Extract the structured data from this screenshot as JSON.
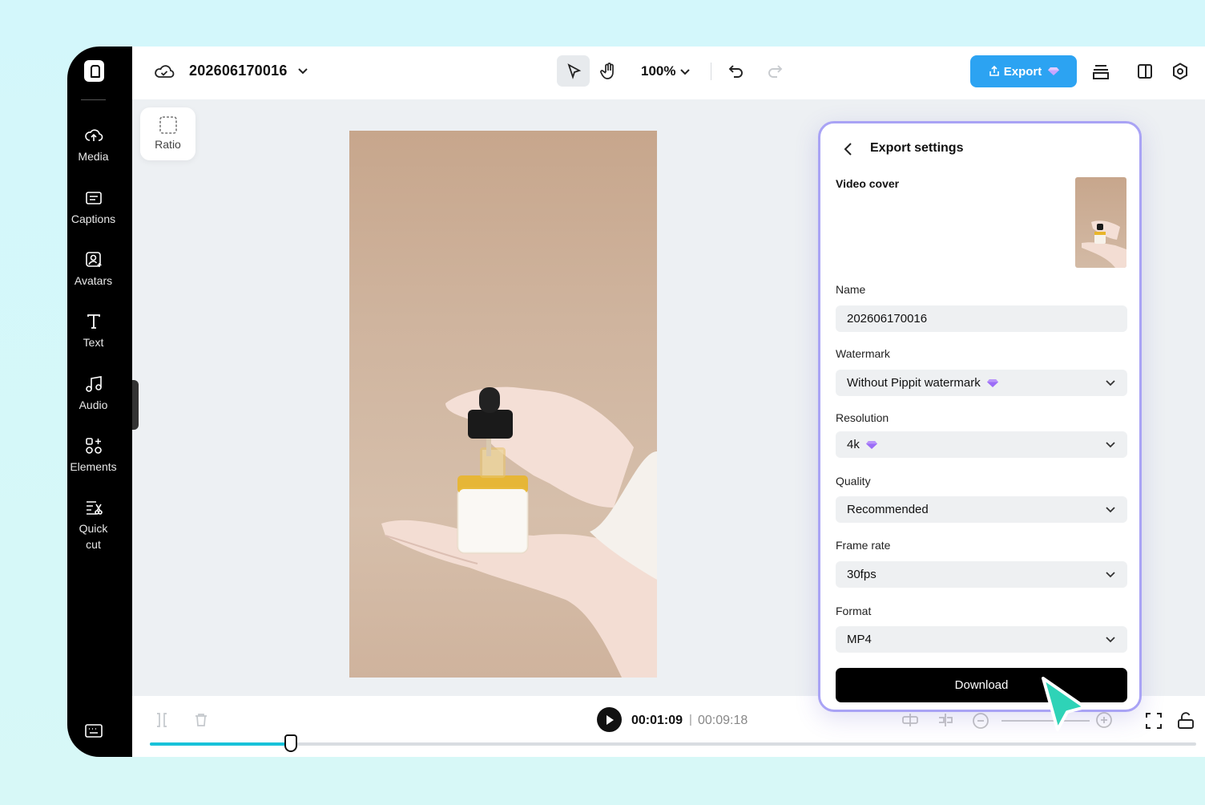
{
  "sidebar": {
    "items": [
      {
        "label": "Media",
        "icon": "cloud-upload-icon"
      },
      {
        "label": "Captions",
        "icon": "captions-icon"
      },
      {
        "label": "Avatars",
        "icon": "avatar-icon"
      },
      {
        "label": "Text",
        "icon": "text-icon"
      },
      {
        "label": "Audio",
        "icon": "music-note-icon"
      },
      {
        "label": "Elements",
        "icon": "elements-icon"
      },
      {
        "label": "Quick",
        "label2": "cut",
        "icon": "quick-cut-icon"
      }
    ]
  },
  "header": {
    "project_title": "202606170016",
    "zoom": "100%",
    "export_label": "Export"
  },
  "canvas": {
    "ratio_label": "Ratio"
  },
  "timeline": {
    "current_time": "00:01:09",
    "separator": "|",
    "total_time": "00:09:18",
    "progress": 0.135
  },
  "export_panel": {
    "title": "Export settings",
    "video_cover_label": "Video cover",
    "name_label": "Name",
    "name_value": "202606170016",
    "watermark_label": "Watermark",
    "watermark_value": "Without Pippit watermark",
    "resolution_label": "Resolution",
    "resolution_value": "4k",
    "quality_label": "Quality",
    "quality_value": "Recommended",
    "frame_rate_label": "Frame rate",
    "frame_rate_value": "30fps",
    "format_label": "Format",
    "format_value": "MP4",
    "download_label": "Download"
  },
  "colors": {
    "accent": "#2ca3f2",
    "panel_border": "#a9a3f5",
    "progress": "#18c2d9",
    "premium_gem": "#9b6cf7"
  }
}
